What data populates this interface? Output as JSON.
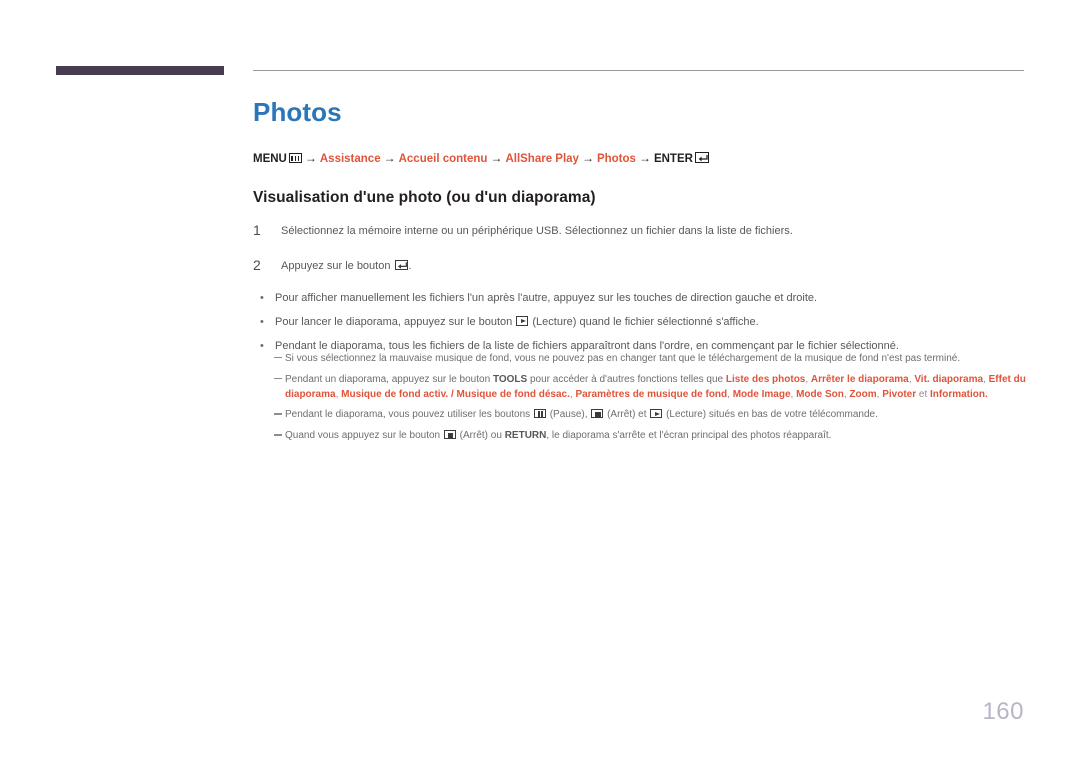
{
  "document": {
    "title": "Photos",
    "title_color": "#2b76b9",
    "accent_color": "#e0543a",
    "rule_bar_color": "#473c52",
    "page_number": "160"
  },
  "breadcrumb": {
    "menu_label": "MENU",
    "menu_icon": "menu-box-icon",
    "enter_label": "ENTER",
    "enter_icon": "enter-key-icon",
    "arrow": "→",
    "items": [
      {
        "label": "Assistance",
        "accent": true
      },
      {
        "label": "Accueil contenu",
        "accent": true
      },
      {
        "label": "AllShare Play",
        "accent": true
      },
      {
        "label": "Photos",
        "accent": true
      }
    ]
  },
  "section": {
    "heading": "Visualisation d'une photo (ou d'un diaporama)"
  },
  "steps": [
    {
      "number": "1",
      "text": "Sélectionnez la mémoire interne ou un périphérique USB. Sélectionnez un fichier dans la liste de fichiers."
    },
    {
      "number": "2",
      "text_before": "Appuyez sur le bouton ",
      "icon": "enter-key-icon",
      "text_after": "."
    }
  ],
  "bullets": [
    {
      "marker": "•",
      "text": "Pour afficher manuellement les fichiers l'un après l'autre, appuyez sur les touches de direction gauche et droite."
    },
    {
      "marker": "•",
      "text_before": "Pour lancer le diaporama, appuyez sur le bouton ",
      "icon": "play-button-icon",
      "text_after": " (Lecture) quand le fichier sélectionné s'affiche."
    },
    {
      "marker": "•",
      "text": "Pendant le diaporama, tous les fichiers de la liste de fichiers apparaîtront dans l'ordre, en commençant par le fichier sélectionné."
    }
  ],
  "notes": [
    {
      "id": "note-background-music",
      "text": "Si vous sélectionnez la mauvaise musique de fond, vous ne pouvez pas en changer tant que le téléchargement de la musique de fond n'est pas terminé."
    },
    {
      "id": "note-tools",
      "text_1": "Pendant un diaporama, appuyez sur le bouton ",
      "bold_1": "TOOLS",
      "text_2": " pour accéder à d'autres fonctions telles que ",
      "options": [
        "Liste des photos",
        "Arrêter le diaporama",
        "Vit. diaporama",
        "Effet du diaporama",
        "Musique de fond activ. / Musique de fond désac.",
        "Paramètres de musique de fond",
        "Mode Image",
        "Mode Son",
        "Zoom",
        "Pivoter"
      ],
      "conjunction": " et ",
      "last_option": "Information",
      "terminator": "."
    },
    {
      "id": "note-playback-buttons",
      "text_1": "Pendant le diaporama, vous pouvez utiliser les boutons ",
      "icon_1": "pause-button-icon",
      "text_2": " (Pause), ",
      "icon_2": "stop-button-icon",
      "text_3": " (Arrêt) et ",
      "icon_3": "play-button-icon",
      "text_4": " (Lecture) situés en bas de votre télécommande."
    },
    {
      "id": "note-return",
      "text_1": "Quand vous appuyez sur le bouton ",
      "icon_1": "stop-button-icon",
      "text_2": " (Arrêt) ou ",
      "bold_1": "RETURN",
      "text_3": ", le diaporama s'arrête et l'écran principal des photos réapparaît."
    }
  ]
}
